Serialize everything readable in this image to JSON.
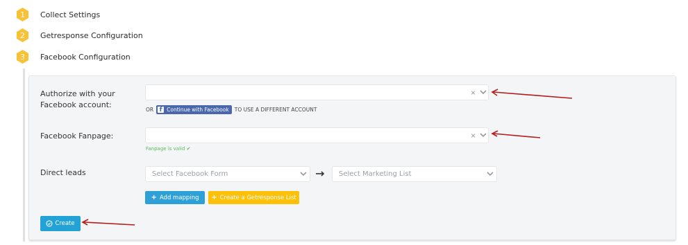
{
  "steps": [
    {
      "number": "1",
      "label": "Collect Settings"
    },
    {
      "number": "2",
      "label": "Getresponse Configuration"
    },
    {
      "number": "3",
      "label": "Facebook Configuration"
    }
  ],
  "colors": {
    "step_badge": "#f9c136",
    "panel_bg": "#f4f5f7",
    "primary": "#2ea0d8",
    "warning": "#ffc009",
    "facebook": "#4a66ad",
    "success": "#5cb85c",
    "annotation_arrow": "#b31b1b"
  },
  "form": {
    "authorize": {
      "label": "Authorize with your Facebook account:",
      "hint_prefix": "OR",
      "fb_button_label": "Continue with Facebook",
      "fb_button_icon": "facebook-icon",
      "hint_suffix": "TO USE A DIFFERENT ACCOUNT"
    },
    "fanpage": {
      "label": "Facebook Fanpage:",
      "status": "Fanpage is valid ✔"
    },
    "direct_leads": {
      "label": "Direct leads",
      "form_placeholder": "Select Facebook Form",
      "arrow_icon": "arrow-right-icon",
      "list_placeholder": "Select Marketing List"
    },
    "add_mapping_label": "Add mapping",
    "create_list_label": "Create a Getresponse List",
    "create_label": "Create"
  },
  "icons": {
    "clear": "×",
    "chevron": "chevron-down-icon",
    "plus": "+",
    "check_circle": "check-circle-icon"
  }
}
